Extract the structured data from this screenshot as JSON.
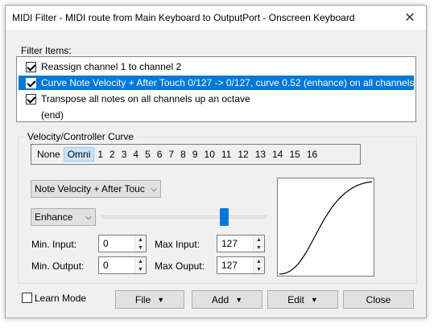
{
  "window": {
    "title": "MIDI Filter - MIDI route from Main Keyboard to OutputPort - Onscreen Keyboard",
    "close_glyph": "✕"
  },
  "filter_items": {
    "label": "Filter Items:",
    "items": [
      {
        "label": "Reassign channel 1 to channel 2",
        "checked": true,
        "selected": false
      },
      {
        "label": "Curve Note Velocity + After Touch 0/127 -> 0/127, curve 0.52 (enhance) on all channels",
        "checked": true,
        "selected": true
      },
      {
        "label": "Transpose all notes on all channels up an octave",
        "checked": true,
        "selected": false
      }
    ],
    "end_label": "(end)"
  },
  "curve_group": {
    "title": "Velocity/Controller Curve",
    "channels": [
      "None",
      "Omni",
      "1",
      "2",
      "3",
      "4",
      "5",
      "6",
      "7",
      "8",
      "9",
      "10",
      "11",
      "12",
      "13",
      "14",
      "15",
      "16"
    ],
    "active_channel": "Omni",
    "target_select": "Note Velocity + After Touc",
    "mode_select": "Enhance",
    "slider_level": 0.75,
    "min_input": {
      "label": "Min. Input:",
      "value": "0"
    },
    "max_input": {
      "label": "Max Input:",
      "value": "127"
    },
    "min_output": {
      "label": "Min. Output:",
      "value": "0"
    },
    "max_output": {
      "label": "Max Ouput:",
      "value": "127"
    }
  },
  "footer": {
    "learn_mode": "Learn Mode",
    "file": "File",
    "add": "Add",
    "edit": "Edit",
    "close": "Close"
  },
  "colors": {
    "selection": "#0078d7",
    "accent": "#0078d7"
  },
  "icons": {
    "close": "close-icon",
    "dropdown": "chevron-down-icon",
    "spin": "spin-arrows-icon"
  }
}
